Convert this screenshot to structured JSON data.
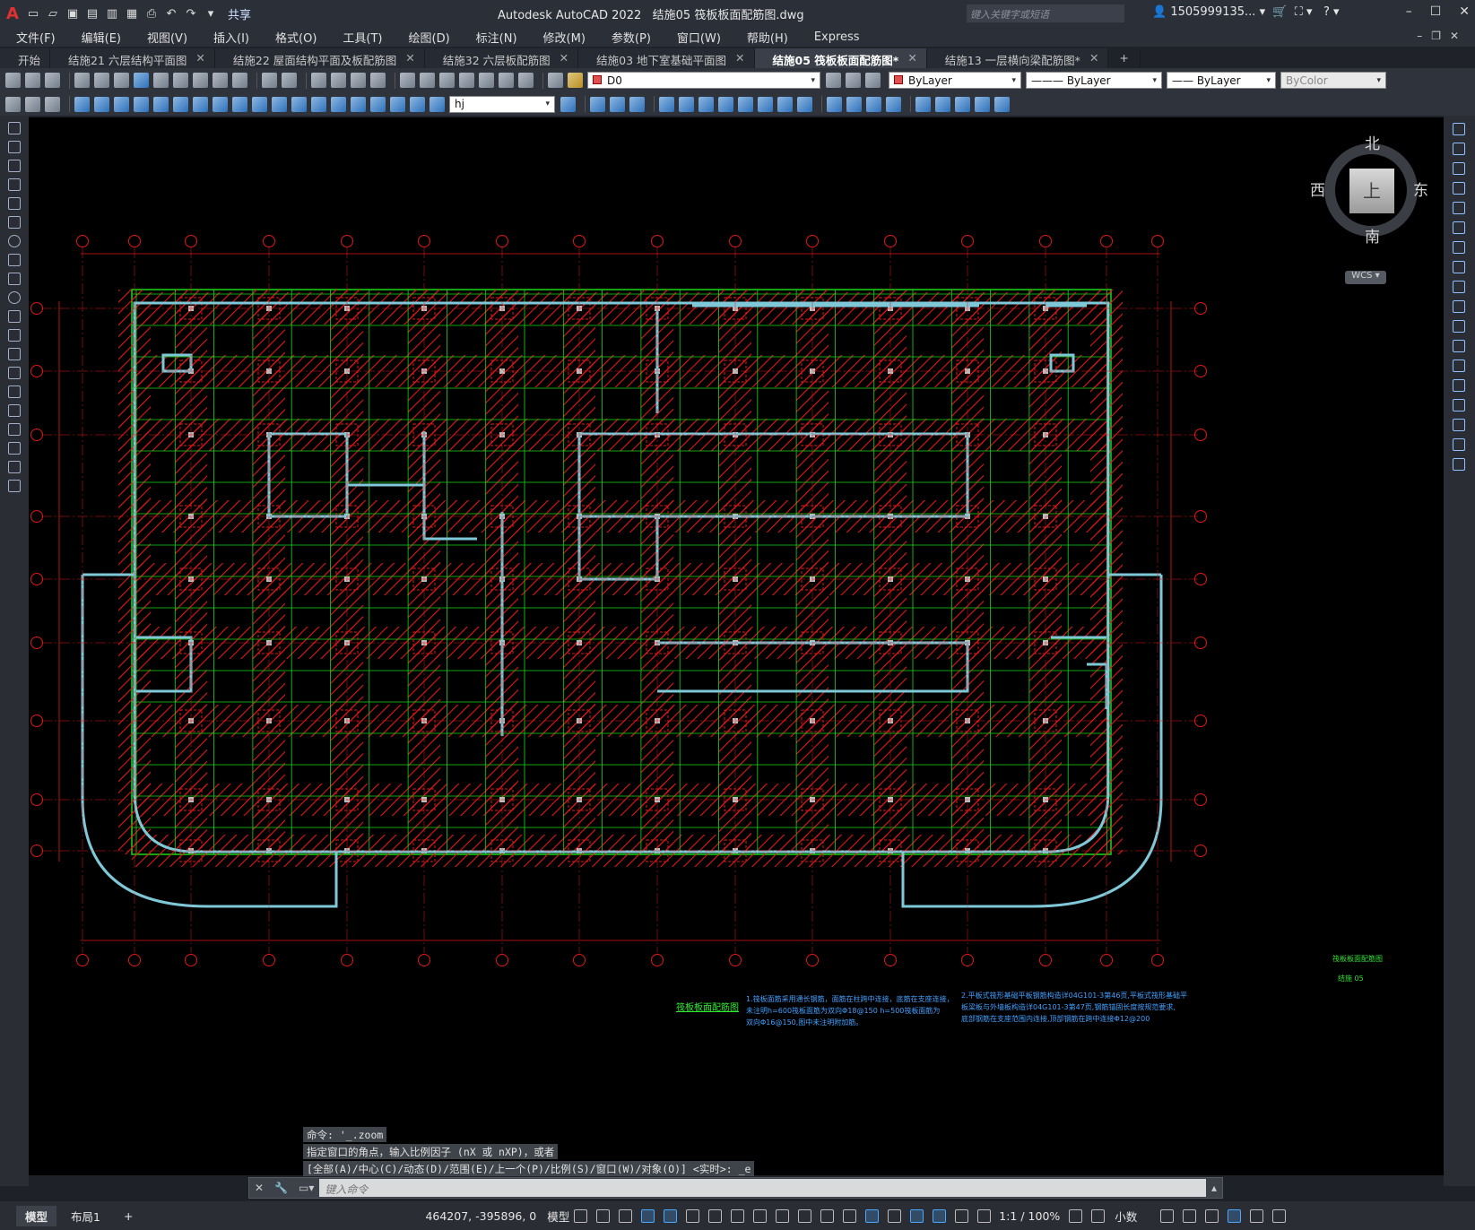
{
  "app": {
    "title": "Autodesk AutoCAD 2022",
    "file": "结施05 筏板板面配筋图.dwg",
    "logo": "A",
    "share": "共享",
    "search_placeholder": "键入关键字或短语",
    "user": "1505999135...",
    "window_controls": [
      "–",
      "☐",
      "✕"
    ]
  },
  "menu": [
    "文件(F)",
    "编辑(E)",
    "视图(V)",
    "插入(I)",
    "格式(O)",
    "工具(T)",
    "绘图(D)",
    "标注(N)",
    "修改(M)",
    "参数(P)",
    "窗口(W)",
    "帮助(H)",
    "Express"
  ],
  "tabs": [
    {
      "label": "开始",
      "closable": false
    },
    {
      "label": "结施21 六层结构平面图",
      "closable": true
    },
    {
      "label": "结施22 屋面结构平面及板配筋图",
      "closable": true
    },
    {
      "label": "结施32 六层板配筋图",
      "closable": true
    },
    {
      "label": "结施03 地下室基础平面图",
      "closable": true
    },
    {
      "label": "结施05 筏板板面配筋图*",
      "closable": true,
      "active": true
    },
    {
      "label": "结施13 一层横向梁配筋图*",
      "closable": true
    }
  ],
  "toolbar": {
    "layer": "D0",
    "color": "ByLayer",
    "linetype": "ByLayer",
    "lineweight": "ByLayer",
    "plotstyle": "ByColor",
    "dimstyle": "hj"
  },
  "viewcube": {
    "north": "北",
    "south": "南",
    "east": "东",
    "west": "西",
    "top": "上",
    "wcs": "WCS"
  },
  "drawing": {
    "title": "筏板板面配筋图",
    "sheet_title": "筏板板面配筋图",
    "sheet_no": "结施 05",
    "note1": [
      "1.筏板面筋采用通长钢筋，面筋在柱跨中连接，底筋在支座连接，",
      "未注明h=600筏板面筋为双向Φ18@150 h=500筏板面筋为",
      "双向Φ16@150,图中未注明附加筋。"
    ],
    "note2": [
      "2.平板式筏形基础平板钢筋构造详04G101-3第46页,平板式筏形基础平",
      "板梁板与外墙板构造详04G101-3第47页,钢筋锚固长度按规范要求,",
      "底部钢筋在支座范围内连接,顶部钢筋在跨中连接Φ12@200"
    ]
  },
  "command": {
    "history": [
      "命令: '_.zoom",
      "指定窗口的角点，输入比例因子 (nX 或 nXP)，或者",
      "[全部(A)/中心(C)/动态(D)/范围(E)/上一个(P)/比例(S)/窗口(W)/对象(O)] <实时>: _e"
    ],
    "placeholder": "键入命令"
  },
  "status": {
    "layout_tabs": [
      "模型",
      "布局1"
    ],
    "coords": "464207, -395896, 0",
    "space": "模型",
    "scale": "1:1 / 100%",
    "units": "小数"
  },
  "colors": {
    "grid_red": "#e01818",
    "grid_green": "#18d818",
    "wall_cyan": "#7fc8d8",
    "text_blue": "#40a0ff"
  }
}
